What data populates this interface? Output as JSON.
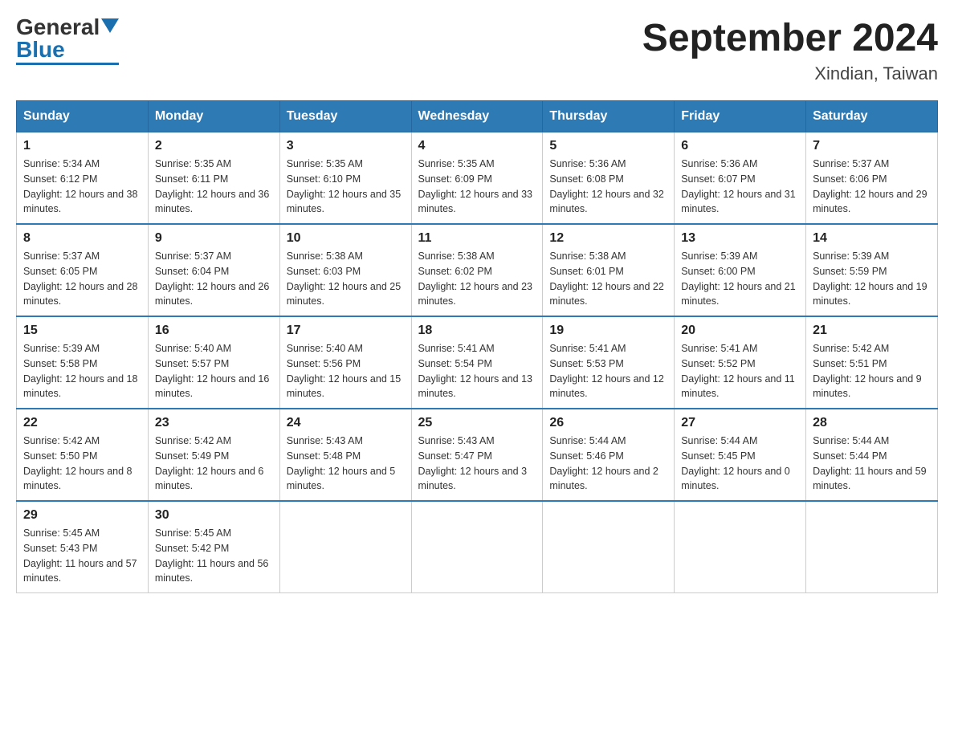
{
  "header": {
    "logo_general": "General",
    "logo_blue": "Blue",
    "month_year": "September 2024",
    "location": "Xindian, Taiwan"
  },
  "days_of_week": [
    "Sunday",
    "Monday",
    "Tuesday",
    "Wednesday",
    "Thursday",
    "Friday",
    "Saturday"
  ],
  "weeks": [
    [
      {
        "day": "1",
        "sunrise": "5:34 AM",
        "sunset": "6:12 PM",
        "daylight": "12 hours and 38 minutes."
      },
      {
        "day": "2",
        "sunrise": "5:35 AM",
        "sunset": "6:11 PM",
        "daylight": "12 hours and 36 minutes."
      },
      {
        "day": "3",
        "sunrise": "5:35 AM",
        "sunset": "6:10 PM",
        "daylight": "12 hours and 35 minutes."
      },
      {
        "day": "4",
        "sunrise": "5:35 AM",
        "sunset": "6:09 PM",
        "daylight": "12 hours and 33 minutes."
      },
      {
        "day": "5",
        "sunrise": "5:36 AM",
        "sunset": "6:08 PM",
        "daylight": "12 hours and 32 minutes."
      },
      {
        "day": "6",
        "sunrise": "5:36 AM",
        "sunset": "6:07 PM",
        "daylight": "12 hours and 31 minutes."
      },
      {
        "day": "7",
        "sunrise": "5:37 AM",
        "sunset": "6:06 PM",
        "daylight": "12 hours and 29 minutes."
      }
    ],
    [
      {
        "day": "8",
        "sunrise": "5:37 AM",
        "sunset": "6:05 PM",
        "daylight": "12 hours and 28 minutes."
      },
      {
        "day": "9",
        "sunrise": "5:37 AM",
        "sunset": "6:04 PM",
        "daylight": "12 hours and 26 minutes."
      },
      {
        "day": "10",
        "sunrise": "5:38 AM",
        "sunset": "6:03 PM",
        "daylight": "12 hours and 25 minutes."
      },
      {
        "day": "11",
        "sunrise": "5:38 AM",
        "sunset": "6:02 PM",
        "daylight": "12 hours and 23 minutes."
      },
      {
        "day": "12",
        "sunrise": "5:38 AM",
        "sunset": "6:01 PM",
        "daylight": "12 hours and 22 minutes."
      },
      {
        "day": "13",
        "sunrise": "5:39 AM",
        "sunset": "6:00 PM",
        "daylight": "12 hours and 21 minutes."
      },
      {
        "day": "14",
        "sunrise": "5:39 AM",
        "sunset": "5:59 PM",
        "daylight": "12 hours and 19 minutes."
      }
    ],
    [
      {
        "day": "15",
        "sunrise": "5:39 AM",
        "sunset": "5:58 PM",
        "daylight": "12 hours and 18 minutes."
      },
      {
        "day": "16",
        "sunrise": "5:40 AM",
        "sunset": "5:57 PM",
        "daylight": "12 hours and 16 minutes."
      },
      {
        "day": "17",
        "sunrise": "5:40 AM",
        "sunset": "5:56 PM",
        "daylight": "12 hours and 15 minutes."
      },
      {
        "day": "18",
        "sunrise": "5:41 AM",
        "sunset": "5:54 PM",
        "daylight": "12 hours and 13 minutes."
      },
      {
        "day": "19",
        "sunrise": "5:41 AM",
        "sunset": "5:53 PM",
        "daylight": "12 hours and 12 minutes."
      },
      {
        "day": "20",
        "sunrise": "5:41 AM",
        "sunset": "5:52 PM",
        "daylight": "12 hours and 11 minutes."
      },
      {
        "day": "21",
        "sunrise": "5:42 AM",
        "sunset": "5:51 PM",
        "daylight": "12 hours and 9 minutes."
      }
    ],
    [
      {
        "day": "22",
        "sunrise": "5:42 AM",
        "sunset": "5:50 PM",
        "daylight": "12 hours and 8 minutes."
      },
      {
        "day": "23",
        "sunrise": "5:42 AM",
        "sunset": "5:49 PM",
        "daylight": "12 hours and 6 minutes."
      },
      {
        "day": "24",
        "sunrise": "5:43 AM",
        "sunset": "5:48 PM",
        "daylight": "12 hours and 5 minutes."
      },
      {
        "day": "25",
        "sunrise": "5:43 AM",
        "sunset": "5:47 PM",
        "daylight": "12 hours and 3 minutes."
      },
      {
        "day": "26",
        "sunrise": "5:44 AM",
        "sunset": "5:46 PM",
        "daylight": "12 hours and 2 minutes."
      },
      {
        "day": "27",
        "sunrise": "5:44 AM",
        "sunset": "5:45 PM",
        "daylight": "12 hours and 0 minutes."
      },
      {
        "day": "28",
        "sunrise": "5:44 AM",
        "sunset": "5:44 PM",
        "daylight": "11 hours and 59 minutes."
      }
    ],
    [
      {
        "day": "29",
        "sunrise": "5:45 AM",
        "sunset": "5:43 PM",
        "daylight": "11 hours and 57 minutes."
      },
      {
        "day": "30",
        "sunrise": "5:45 AM",
        "sunset": "5:42 PM",
        "daylight": "11 hours and 56 minutes."
      },
      null,
      null,
      null,
      null,
      null
    ]
  ]
}
